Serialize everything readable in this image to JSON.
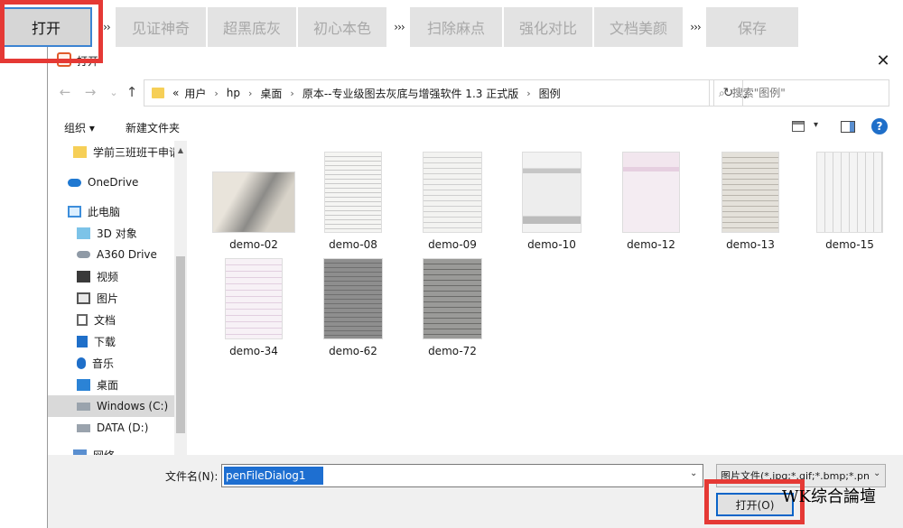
{
  "toolbar": {
    "open_label": "打开",
    "more_symbol": "›››",
    "items": [
      "见证神奇",
      "超黑底灰",
      "初心本色",
      "扫除麻点",
      "强化对比",
      "文档美颜",
      "保存"
    ]
  },
  "dialog": {
    "title": "打开",
    "close_symbol": "✕",
    "nav": {
      "back": "←",
      "forward": "→",
      "recent": "⌄",
      "up": "↑"
    },
    "address": {
      "overflow": "«",
      "crumbs": [
        "用户",
        "hp",
        "桌面",
        "原本--专业级图去灰底与增强软件 1.3 正式版",
        "图例"
      ],
      "sep": "›",
      "dropdown": "⌄",
      "refresh": "↻"
    },
    "search": {
      "icon": "⌕",
      "placeholder": "搜索\"图例\""
    },
    "commands": {
      "organize": "组织 ▾",
      "new_folder": "新建文件夹",
      "view_dd": "▾",
      "help": "?"
    },
    "nav_pane": [
      {
        "label": "学前三班班干申请",
        "icon": "folder"
      },
      {
        "label": "OneDrive",
        "icon": "cloud"
      },
      {
        "label": "此电脑",
        "icon": "pc"
      },
      {
        "label": "3D 对象",
        "icon": "cube"
      },
      {
        "label": "A360 Drive",
        "icon": "drive"
      },
      {
        "label": "视频",
        "icon": "video"
      },
      {
        "label": "图片",
        "icon": "picture"
      },
      {
        "label": "文档",
        "icon": "document"
      },
      {
        "label": "下载",
        "icon": "download"
      },
      {
        "label": "音乐",
        "icon": "music"
      },
      {
        "label": "桌面",
        "icon": "desktop"
      },
      {
        "label": "Windows (C:)",
        "icon": "disk"
      },
      {
        "label": "DATA (D:)",
        "icon": "disk"
      },
      {
        "label": "网络",
        "icon": "network"
      }
    ],
    "files": [
      "demo-02",
      "demo-08",
      "demo-09",
      "demo-10",
      "demo-12",
      "demo-13",
      "demo-15",
      "demo-34",
      "demo-62",
      "demo-72"
    ],
    "bottom": {
      "filename_label": "文件名(N):",
      "filename_value": "penFileDialog1",
      "filename_dd": "⌄",
      "filetype": "图片文件(*.jpg;*.gif;*.bmp;*.pn",
      "filetype_dd": "⌄",
      "open_button": "打开(O)"
    }
  },
  "watermark": "WK综合論壇",
  "colors": {
    "highlight_frame": "#e53935",
    "selection": "#1e6fd1",
    "accent": "#0a64c8"
  }
}
